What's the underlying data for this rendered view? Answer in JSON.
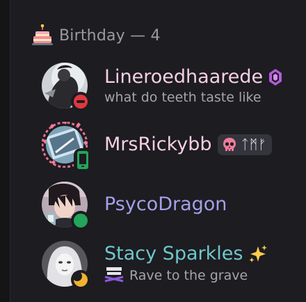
{
  "section": {
    "emoji": "birthday-cake",
    "title": "Birthday — 4"
  },
  "members": [
    {
      "name": "Lineroedhaarede",
      "name_color": "#f6cfe4",
      "status": "do-not-disturb",
      "status_color": "#e0383e",
      "badge_icon": "purple-gem-icon",
      "activity": "what do teeth taste like"
    },
    {
      "name": "MrsRickybb",
      "name_color": "#f6cfe4",
      "status": "online-mobile",
      "status_color": "#23a55a",
      "tag": {
        "icon": "pink-skull-icon",
        "text": "ᛏᛗᚠ"
      }
    },
    {
      "name": "PsycoDragon",
      "name_color": "#a4a0e8",
      "status": "online",
      "status_color": "#23a55a"
    },
    {
      "name": "Stacy Sparkles",
      "name_color": "#6fc7c9",
      "status": "idle",
      "status_color": "#f0b232",
      "badge_icon": "sparkles-icon",
      "activity_icon": "ghost-rave-icon",
      "activity": "Rave to the grave"
    }
  ]
}
